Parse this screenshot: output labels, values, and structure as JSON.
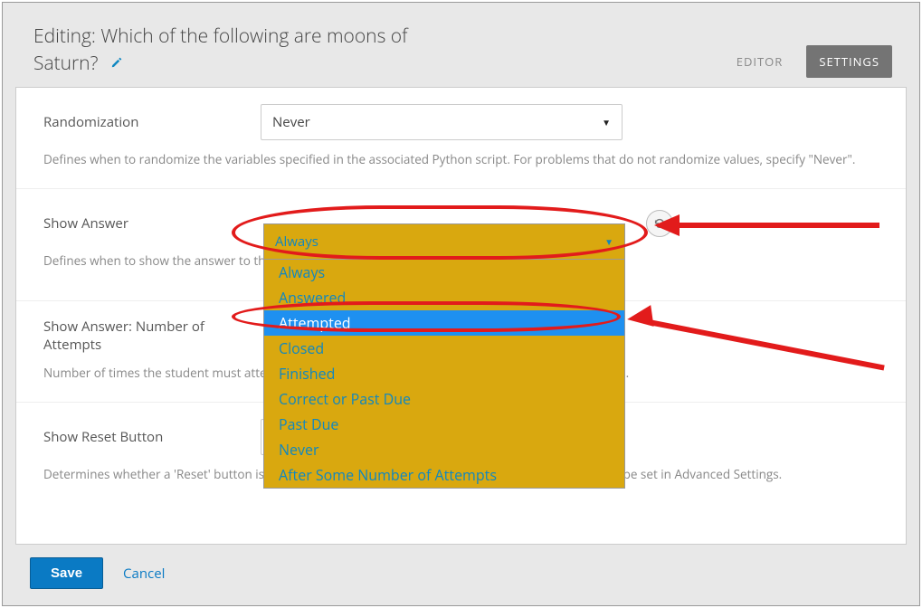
{
  "header": {
    "title_prefix": "Editing: ",
    "question": "Which of the following are moons of Saturn?",
    "edit_icon": "pencil-icon"
  },
  "tabs": {
    "editor": "EDITOR",
    "settings": "SETTINGS",
    "active": "settings"
  },
  "settings": {
    "randomization": {
      "label": "Randomization",
      "value": "Never",
      "desc": "Defines when to randomize the variables specified in the associated Python script. For problems that do not randomize values, specify \"Never\"."
    },
    "show_answer": {
      "label": "Show Answer",
      "value": "Always",
      "desc_partial": "Defines when to show the answer to th",
      "options": [
        "Always",
        "Answered",
        "Attempted",
        "Closed",
        "Finished",
        "Correct or Past Due",
        "Past Due",
        "Never",
        "After Some Number of Attempts"
      ],
      "highlighted": "Attempted"
    },
    "show_answer_num": {
      "label": "Show Answer: Number of Attempts",
      "desc_partial_left": "Number of times the student must atte",
      "desc_partial_right": "ears."
    },
    "show_reset": {
      "label": "Show Reset Button",
      "value": "False",
      "desc": "Determines whether a 'Reset' button is shown so the user may reset their answer. A default value can be set in Advanced Settings."
    }
  },
  "footer": {
    "save": "Save",
    "cancel": "Cancel"
  }
}
